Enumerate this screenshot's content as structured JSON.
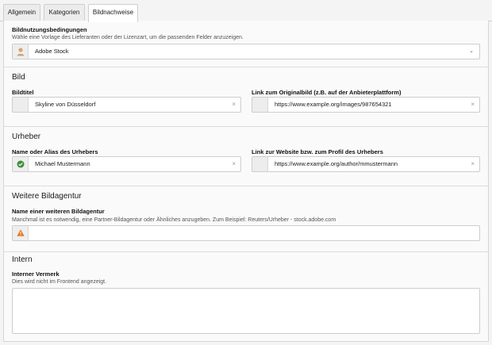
{
  "tabs": [
    {
      "label": "Allgemein"
    },
    {
      "label": "Kategorien"
    },
    {
      "label": "Bildnachweise"
    }
  ],
  "license": {
    "label": "Bildnutzungsbedingungen",
    "help": "Wähle eine Vorlage des Lieferanten oder der Lizenzart, um die passenden Felder anzuzeigen.",
    "selected": "Adobe Stock"
  },
  "bild": {
    "title": "Bild",
    "image_title_label": "Bildtitel",
    "image_title_value": "Skyline von Düsseldorf",
    "link_label": "Link zum Originalbild (z.B. auf der Anbieterplattform)",
    "link_value": "https://www.example.org/images/987654321"
  },
  "urheber": {
    "title": "Urheber",
    "name_label": "Name oder Alias des Urhebers",
    "name_value": "Michael Mustermann",
    "website_label": "Link zur Website bzw. zum Profil des Urhebers",
    "website_value": "https://www.example.org/author/mmustermann"
  },
  "agentur": {
    "title": "Weitere Bildagentur",
    "name_label": "Name einer weiteren Bildagentur",
    "help": "Manchmal ist es notwendig, eine Partner-Bildagentur oder Ähnliches anzugeben. Zum Beispiel: Reuters/Urheber - stock.adobe.com",
    "value": ""
  },
  "intern": {
    "title": "Intern",
    "note_label": "Interner Vermerk",
    "help": "Dies wird nicht im Frontend angezeigt.",
    "value": ""
  },
  "colors": {
    "success": "#3a8f3a",
    "warning": "#e0781f",
    "avatar": "#d8a37a"
  },
  "icons": {
    "clear": "×",
    "chevron": "⌄"
  }
}
